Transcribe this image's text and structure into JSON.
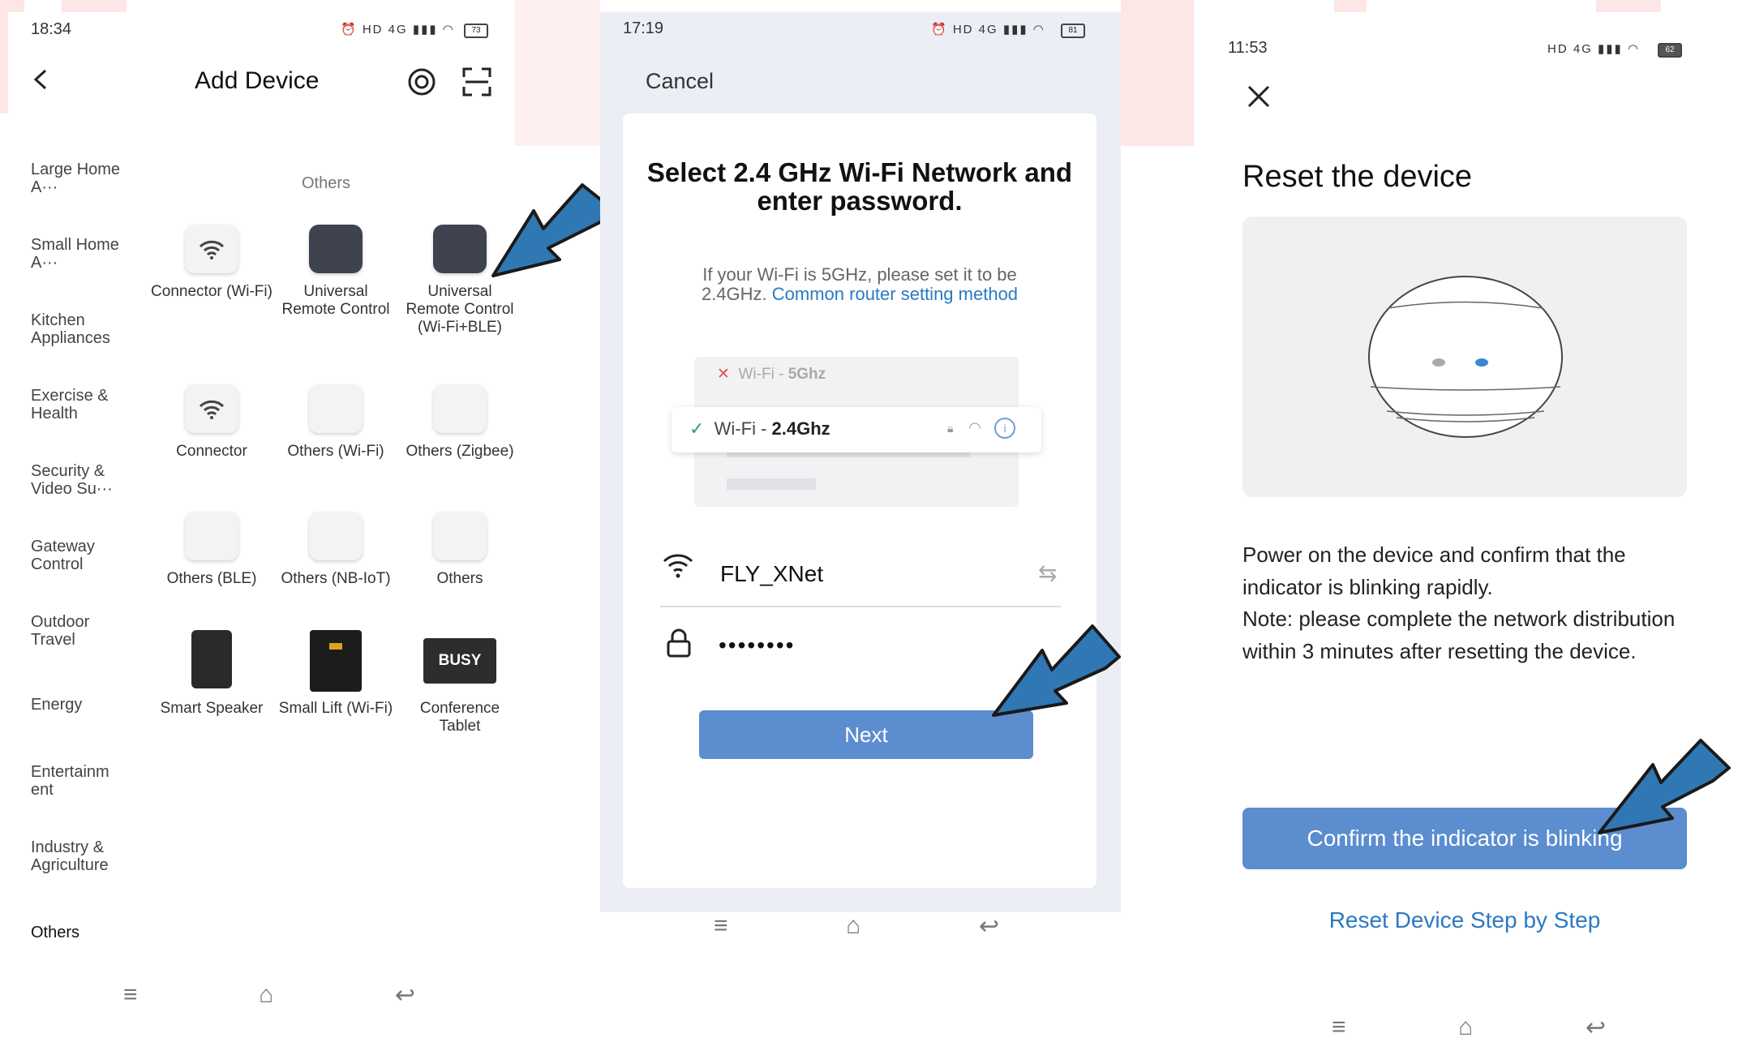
{
  "screen1": {
    "time": "18:34",
    "status_icons": "⏰ HD 4G ▮▮▮ ◠ 73",
    "battery": "73",
    "title": "Add Device",
    "categories": [
      "Large Home A···",
      "Small Home A···",
      "Kitchen Appliances",
      "Exercise & Health",
      "Security & Video Su···",
      "Gateway Control",
      "Outdoor Travel",
      "Energy",
      "Entertainm ent",
      "Industry & Agriculture",
      "Others"
    ],
    "section_header": "Others",
    "devices": [
      "Connector (Wi-Fi)",
      "Universal Remote Control",
      "Universal Remote Control (Wi-Fi+BLE)",
      "Connector",
      "Others (Wi-Fi)",
      "Others (Zigbee)",
      "Others (BLE)",
      "Others (NB-IoT)",
      "Others",
      "Smart Speaker",
      "Small Lift (Wi-Fi)",
      "Conference Tablet"
    ],
    "busy_label": "BUSY"
  },
  "screen2": {
    "time": "17:19",
    "battery": "81",
    "cancel": "Cancel",
    "title": "Select 2.4 GHz Wi-Fi Network and enter password.",
    "subtitle": "If your Wi-Fi is 5GHz, please set it to be 2.4GHz.",
    "link": "Common router setting method",
    "wifi_5_prefix": "Wi-Fi - ",
    "wifi_5_band": "5Ghz",
    "wifi_24_prefix": "Wi-Fi - ",
    "wifi_24_band": "2.4Ghz",
    "ssid": "FLY_XNet",
    "password": "••••••••",
    "next": "Next"
  },
  "screen3": {
    "time": "11:53",
    "battery": "62",
    "title": "Reset the device",
    "body": "Power on the device and confirm that the indicator is blinking rapidly.\nNote: please complete the network distribution within 3 minutes after resetting the device.",
    "confirm": "Confirm the indicator is blinking",
    "reset_link": "Reset Device Step by Step"
  },
  "colors": {
    "accent": "#5b8dcf",
    "link": "#2b79c2",
    "arrow": "#2f78b4"
  }
}
